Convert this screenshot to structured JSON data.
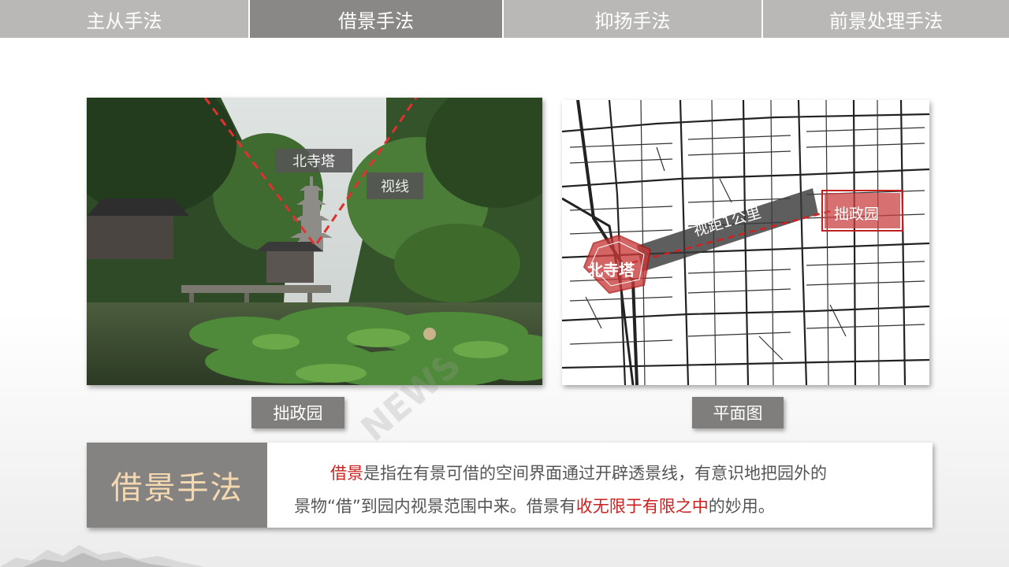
{
  "tabs": [
    {
      "label": "主从手法",
      "active": false
    },
    {
      "label": "借景手法",
      "active": true
    },
    {
      "label": "抑扬手法",
      "active": false
    },
    {
      "label": "前景处理手法",
      "active": false
    }
  ],
  "photo": {
    "tag_pagoda": "北寺塔",
    "tag_sightline": "视线",
    "caption": "拙政园"
  },
  "map": {
    "label_distance": "视距1公里",
    "label_garden": "拙政园",
    "label_pagoda": "北寺塔",
    "caption": "平面图"
  },
  "description": {
    "title": "借景手法",
    "line1_highlight": "借景",
    "line1_rest": "是指在有景可借的空间界面通过开辟透景线，有意识地把园外的",
    "line2_start": "景物“借”到园内视景范围中来。借景有",
    "line2_highlight": "收无限于有限之中",
    "line2_end": "的妙用。"
  },
  "colors": {
    "tab_active": "#8a8886",
    "tab_inactive": "#b9b8b6",
    "title_text": "#f4d9b0",
    "highlight_red": "#cc1f1f"
  }
}
